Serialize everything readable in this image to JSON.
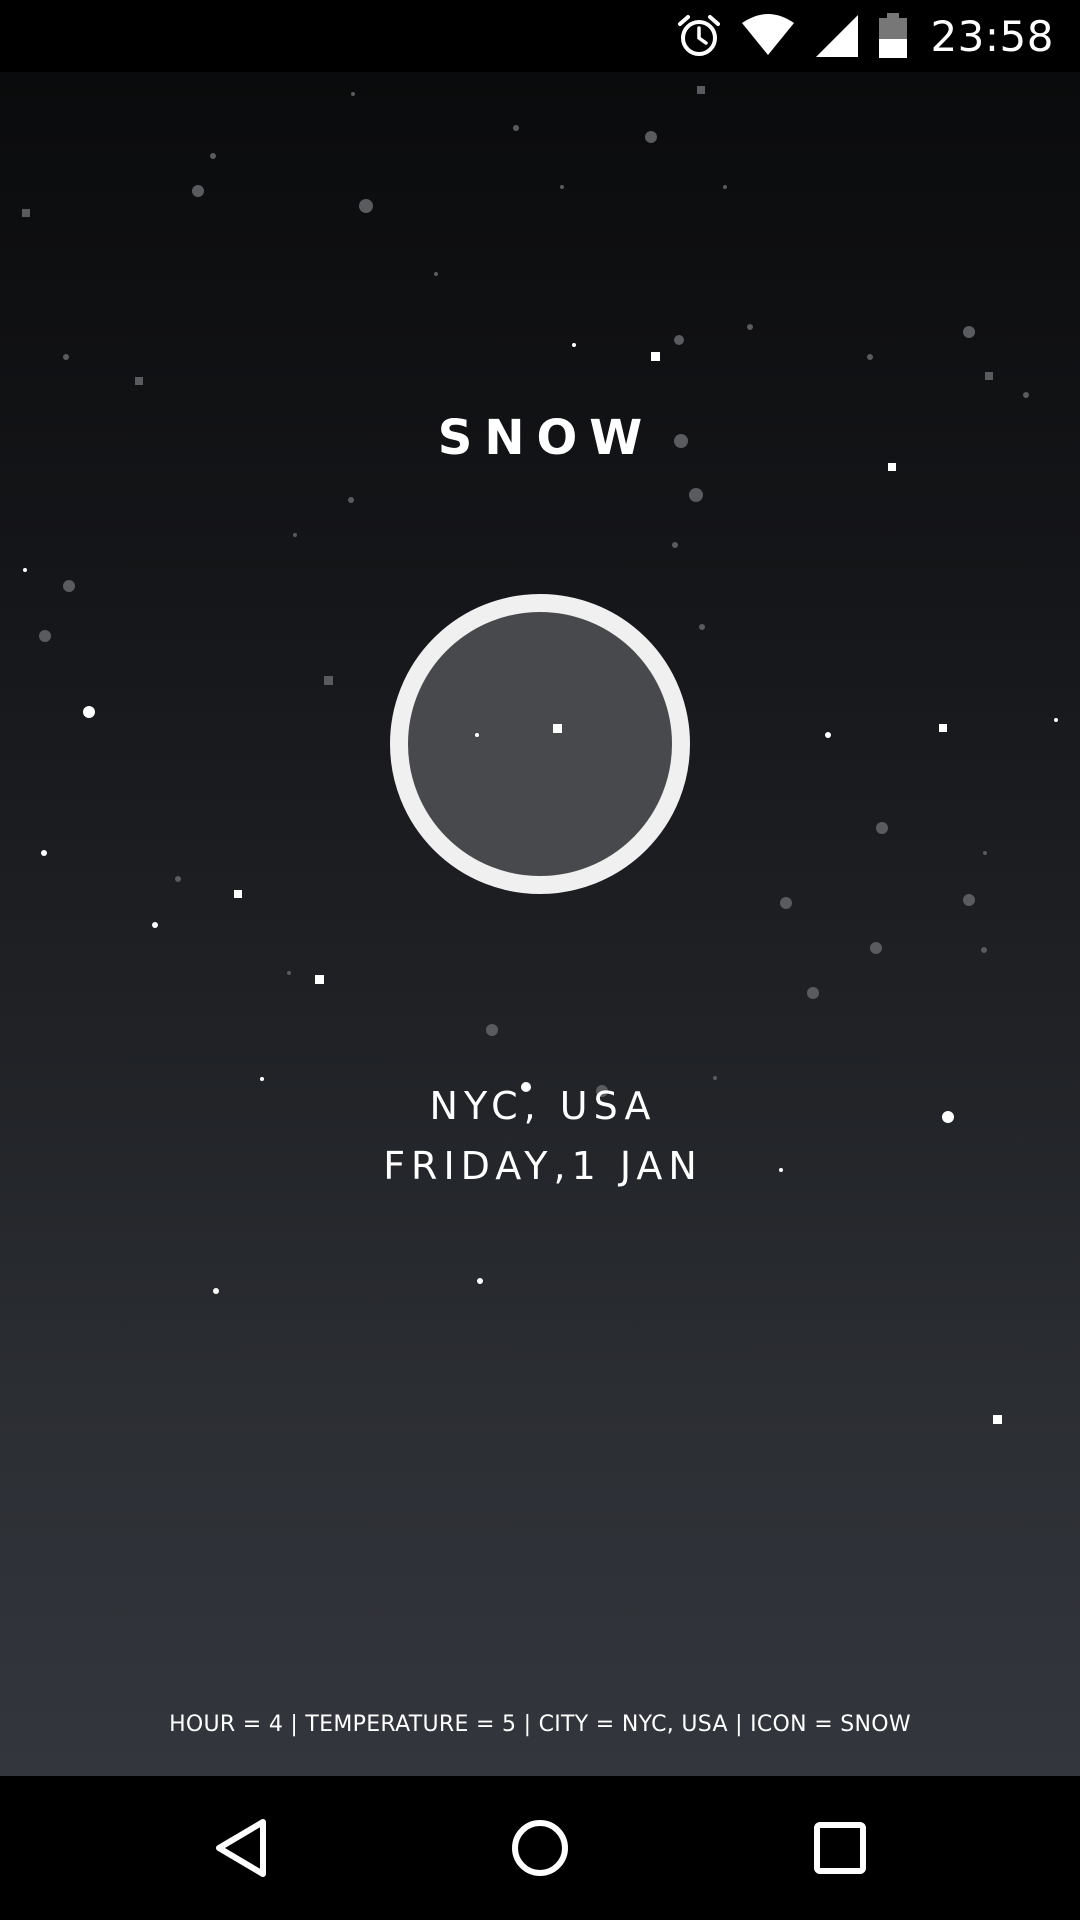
{
  "status_bar": {
    "time": "23:58",
    "icons": [
      "alarm-icon",
      "wifi-icon",
      "cell-signal-icon",
      "battery-icon"
    ]
  },
  "weather": {
    "condition": "SNOW",
    "location": "NYC, USA",
    "date": "FRIDAY,1 JAN",
    "icon": "moon-circle-icon"
  },
  "debug": {
    "text": "HOUR = 4 | TEMPERATURE = 5 | CITY = NYC, USA | ICON = SNOW"
  },
  "nav_bar": {
    "buttons": [
      "back-icon",
      "home-icon",
      "recents-icon"
    ]
  },
  "colors": {
    "background_top": "#0a0b0c",
    "background_bottom": "#33363d",
    "circle_ring": "#f0f0f0",
    "circle_fill": "#48494d",
    "text": "#ffffff"
  }
}
